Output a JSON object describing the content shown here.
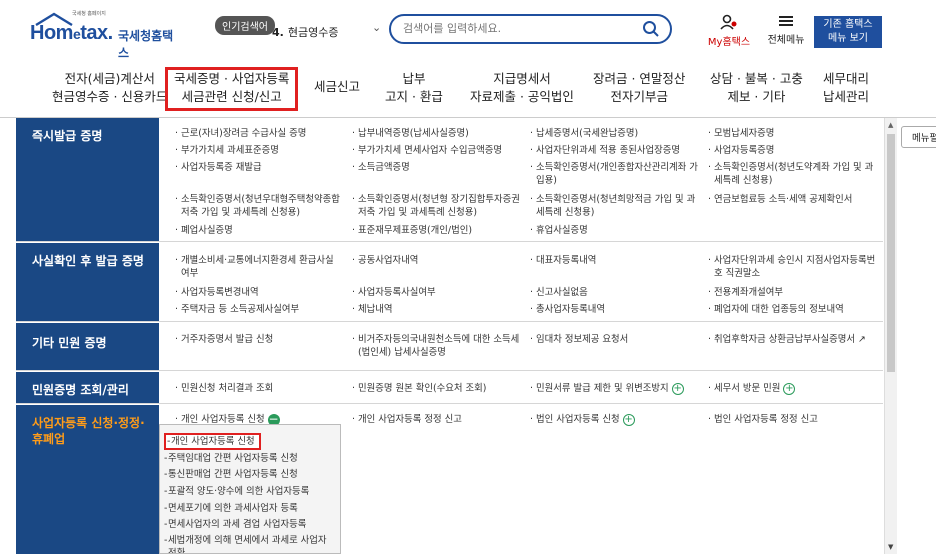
{
  "header": {
    "logo_small": "국세청 홈페이지",
    "logo_word_a": "Hom",
    "logo_word_e": "e",
    "logo_word_b": "tax.",
    "logo_kr": "국세청홈택스",
    "popular_badge": "인기검색어",
    "popular_rank": "4.",
    "popular_term": "현금영수증",
    "search_placeholder": "검색어를 입력하세요.",
    "my_label": "My홈택스",
    "all_menu_label": "전체메뉴",
    "old_btn_line1": "기존 홈택스",
    "old_btn_line2": "메뉴 보기"
  },
  "nav": [
    {
      "l1": "전자(세금)계산서",
      "l2": "현금영수증 · 신용카드"
    },
    {
      "l1": "국세증명 · 사업자등록",
      "l2": "세금관련 신청/신고",
      "active": true
    },
    {
      "l1": "세금신고",
      "l2": ""
    },
    {
      "l1": "납부",
      "l2": "고지 · 환급"
    },
    {
      "l1": "지급명세서",
      "l2": "자료제출 · 공익법인"
    },
    {
      "l1": "장려금 · 연말정산",
      "l2": "전자기부금"
    },
    {
      "l1": "상담 · 불복 · 고충",
      "l2": "제보 · 기타"
    },
    {
      "l1": "세무대리",
      "l2": "납세관리"
    }
  ],
  "sections": {
    "s1": {
      "title": "즉시발급 증명",
      "items": [
        "근로(자녀)장려금 수급사실 증명",
        "납부내역증명(납세사실증명)",
        "납세증명서(국세완납증명)",
        "모범납세자증명",
        "부가가치세 과세표준증명",
        "부가가치세 면세사업자 수입금액증명",
        "사업자단위과세 적용 종된사업장증명",
        "사업자등록증명",
        "사업자등록증 재발급",
        "소득금액증명",
        "소득확인증명서(개인종합자산관리계좌 가입용)",
        "소득확인증명서(청년도약계좌 가입 및 과세특례 신청용)",
        "소득확인증명서(청년우대형주택청약종합저축 가입 및 과세특례 신청용)",
        "소득확인증명서(청년형 장기집합투자증권저축 가입 및 과세특례 신청용)",
        "소득확인증명서(청년희망적금 가입 및 과세특례 신청용)",
        "연금보험료등 소득·세액 공제확인서",
        "폐업사실증명",
        "표준재무제표증명(개인/법인)",
        "휴업사실증명"
      ]
    },
    "s2": {
      "title": "사실확인 후 발급 증명",
      "items": [
        "개별소비세·교통에너지환경세 환급사실 여부",
        "공동사업자내역",
        "대표자등록내역",
        "사업자단위과세 승인시 지점사업자등록번호 직권말소",
        "사업자등록변경내역",
        "사업자등록사실여부",
        "신고사실없음",
        "전용계좌개설여부",
        "주택자금 등 소득공제사실여부",
        "체납내역",
        "총사업자등록내역",
        "폐업자에 대한 업종등의 정보내역"
      ]
    },
    "s3": {
      "title": "기타 민원 증명",
      "items": [
        "거주자증명서 발급 신청",
        "비거주자등의국내원천소득에 대한 소득세(법인세) 납세사실증명",
        "임대차 정보제공 요청서",
        "취업후학자금 상환금납부사실증명서"
      ]
    },
    "s4": {
      "title": "민원증명 조회/관리",
      "items": [
        "민원신청 처리결과 조회",
        "민원증명 원본 확인(수요처 조회)",
        "민원서류 발급 제한 및 위변조방지",
        "세무서 방문 민원"
      ]
    },
    "s5": {
      "title_l1": "사업자등록 신청·정정·",
      "title_l2": "휴폐업",
      "items": [
        "개인 사업자등록 신청",
        "개인 사업자등록 정정 신고",
        "법인 사업자등록 신청",
        "법인 사업자등록 정정 신고"
      ]
    }
  },
  "submenu": [
    "개인 사업자등록 신청",
    "주택임대업 간편 사업자등록 신청",
    "통신판매업 간편 사업자등록 신청",
    "포괄적 양도·양수에 의한 사업자등록",
    "면세포기에 의한 과세사업자 등록",
    "면세사업자의 과세 겸업 사업자등록",
    "세법개정에 의해 면세에서 과세로 사업자 전환"
  ],
  "side_menu": "메뉴펼"
}
